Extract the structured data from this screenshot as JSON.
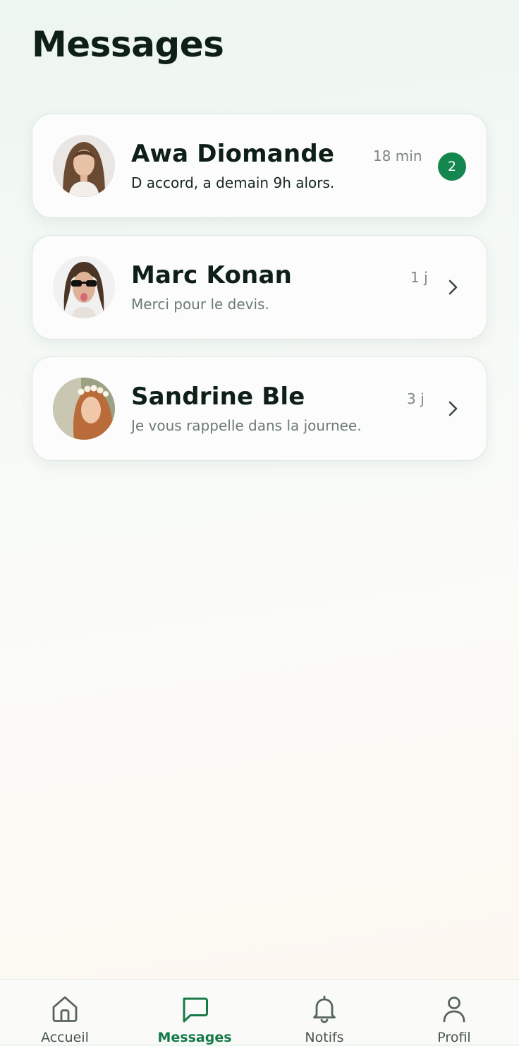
{
  "header": {
    "title": "Messages"
  },
  "conversations": [
    {
      "name": "Awa Diomande",
      "preview": "D accord, a demain 9h alors.",
      "time": "18 min",
      "unread_count": "2"
    },
    {
      "name": "Marc Konan",
      "preview": "Merci pour le devis.",
      "time": "1 j"
    },
    {
      "name": "Sandrine Ble",
      "preview": "Je vous rappelle dans la journee.",
      "time": "3 j"
    }
  ],
  "bottom_nav": {
    "items": [
      {
        "label": "Accueil",
        "icon": "home-icon"
      },
      {
        "label": "Messages",
        "icon": "message-square-icon",
        "active": true
      },
      {
        "label": "Notifs",
        "icon": "bell-icon"
      },
      {
        "label": "Profil",
        "icon": "user-icon"
      }
    ]
  },
  "colors": {
    "accent": "#14874e",
    "active_nav": "#167a48",
    "title": "#0e1f17",
    "muted_text": "#6c7a73"
  }
}
